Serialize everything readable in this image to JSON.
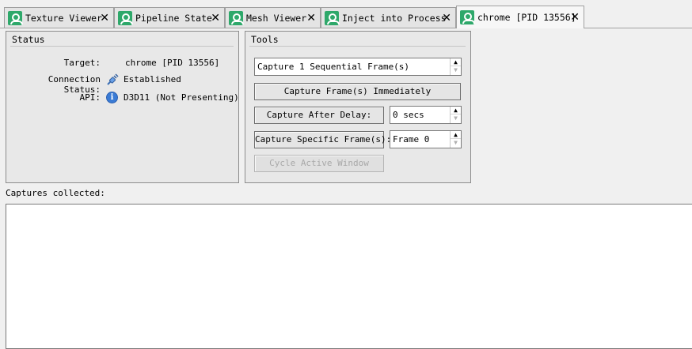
{
  "tabs": [
    {
      "label": "Texture Viewer",
      "active": false
    },
    {
      "label": "Pipeline State",
      "active": false
    },
    {
      "label": "Mesh Viewer",
      "active": false
    },
    {
      "label": "Inject into Process",
      "active": false
    },
    {
      "label": "chrome [PID 13556]",
      "active": true
    }
  ],
  "tab_close_glyph": "✕",
  "status": {
    "title": "Status",
    "target_label": "Target:",
    "target_value": "chrome [PID 13556]",
    "connection_label": "Connection Status:",
    "connection_value": "Established",
    "connection_icon": "plug-connected-icon",
    "api_label": "API:",
    "api_value": "D3D11 (Not Presenting)",
    "api_icon": "info-icon",
    "api_icon_glyph": "i"
  },
  "tools": {
    "title": "Tools",
    "capture_count": "Capture 1 Sequential Frame(s)",
    "capture_now": "Capture Frame(s) Immediately",
    "capture_after_delay": "Capture After Delay:",
    "delay_value": "0 secs",
    "capture_specific": "Capture Specific Frame(s):",
    "frame_value": "Frame 0",
    "cycle_window": "Cycle Active Window",
    "spin_up": "▲",
    "spin_down": "▼"
  },
  "captures": {
    "label": "Captures collected:",
    "items": []
  },
  "colors": {
    "tab_icon": "#2ea86a",
    "info_icon": "#3a7bd5"
  }
}
